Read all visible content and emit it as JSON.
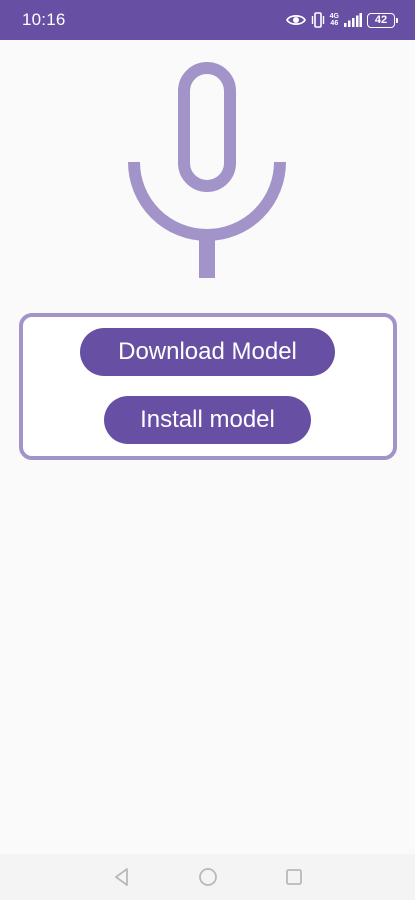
{
  "status_bar": {
    "time": "10:16",
    "network_top": "4G",
    "network_bottom": "46",
    "battery": "42",
    "icons": [
      "eye-icon",
      "vibrate-icon",
      "signal-icon",
      "battery-icon"
    ]
  },
  "colors": {
    "primary": "#6750a4",
    "mic": "#a294c9",
    "background": "#fafafa"
  },
  "main": {
    "illustration": "microphone-icon",
    "download_label": "Download Model",
    "install_label": "Install model"
  },
  "nav_bar": {
    "icons": [
      "back-icon",
      "home-icon",
      "recents-icon"
    ]
  }
}
